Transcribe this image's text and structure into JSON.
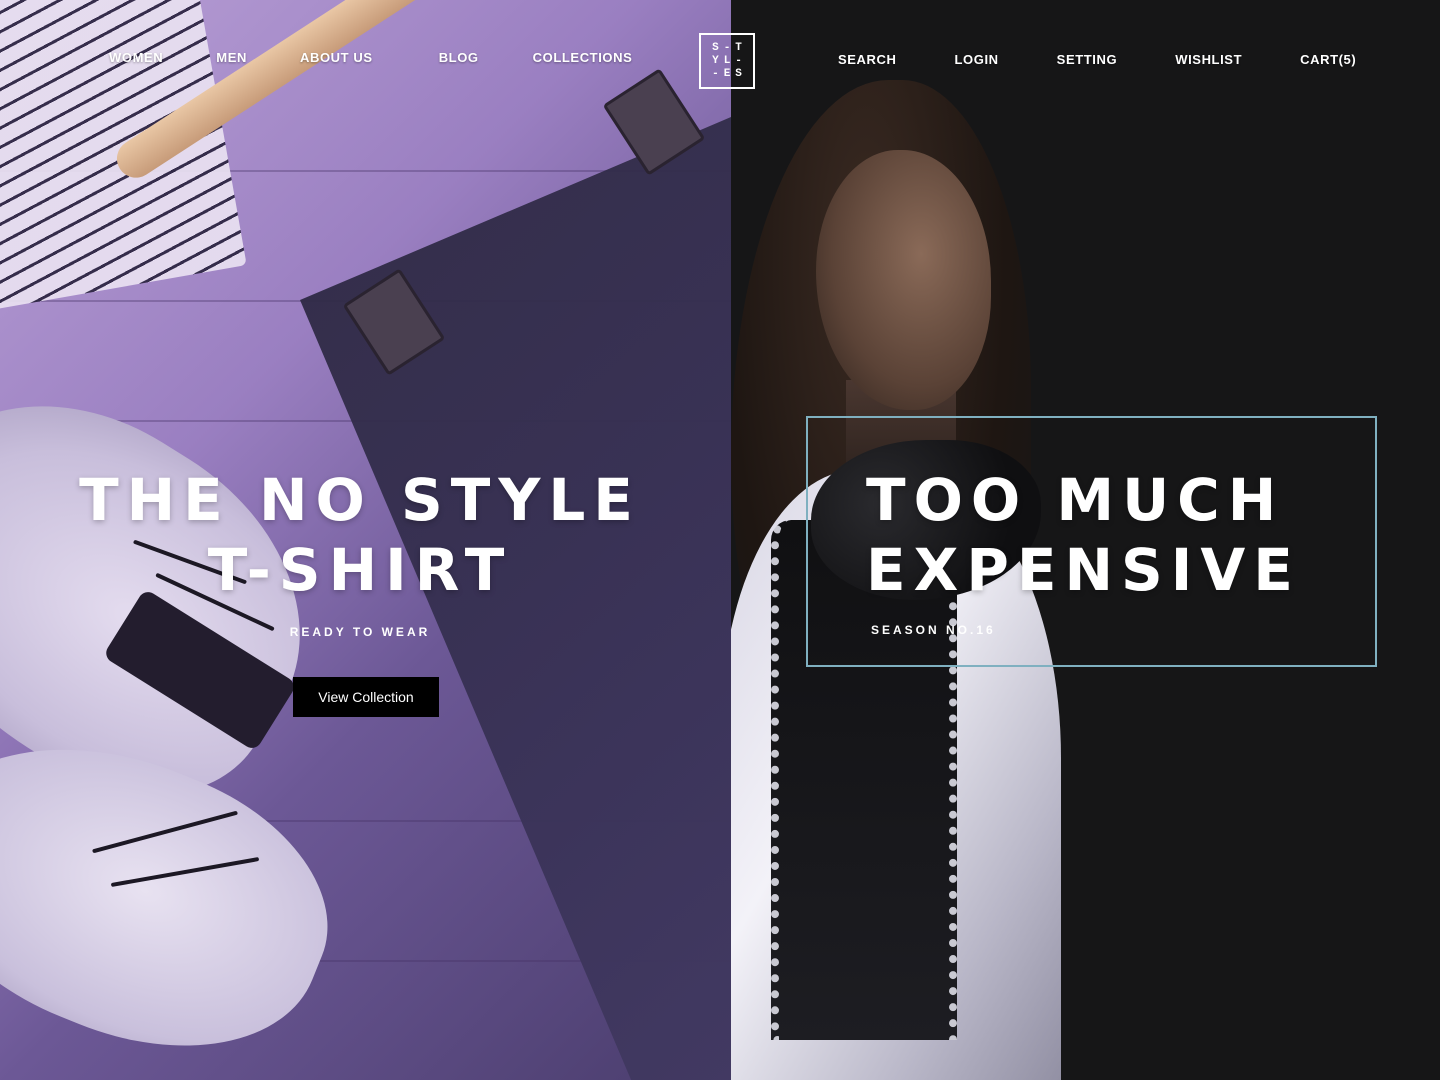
{
  "nav": {
    "left": [
      "WOMEN",
      "MEN",
      "ABOUT US",
      "BLOG",
      "COLLECTIONS"
    ],
    "right": [
      "SEARCH",
      "LOGIN",
      "SETTING",
      "WISHLIST",
      "CART(5)"
    ]
  },
  "logo": {
    "lines": [
      "S-T",
      "YL-",
      "-ES"
    ]
  },
  "hero_left": {
    "title_line1": "THE NO STYLE",
    "title_line2": "T-SHIRT",
    "subtitle": "READY TO WEAR",
    "button": "View Collection"
  },
  "hero_right": {
    "title_line1": "TOO MUCH",
    "title_line2": "EXPENSIVE",
    "subtitle": "SEASON NO.16"
  },
  "colors": {
    "left_overlay": "#8a72b3",
    "right_background": "#161617",
    "frame_border": "#7fb0c0",
    "button_background": "#000000"
  }
}
